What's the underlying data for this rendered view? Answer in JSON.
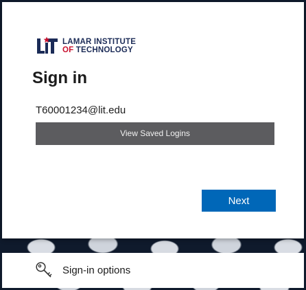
{
  "logo": {
    "mark_alt": "LIT",
    "line1": "LAMAR INSTITUTE",
    "line2_of": "OF",
    "line2_tech": "TECHNOLOGY",
    "colors": {
      "navy": "#1b2b57",
      "red": "#c8102e"
    }
  },
  "signin": {
    "title": "Sign in",
    "username_value": "T60001234@lit.edu",
    "saved_logins_label": "View Saved Logins",
    "next_label": "Next"
  },
  "options": {
    "label": "Sign-in options",
    "icon": "key-icon"
  },
  "colors": {
    "primary_button": "#0067b8",
    "saved_logins_bg": "#5c5c5f"
  }
}
